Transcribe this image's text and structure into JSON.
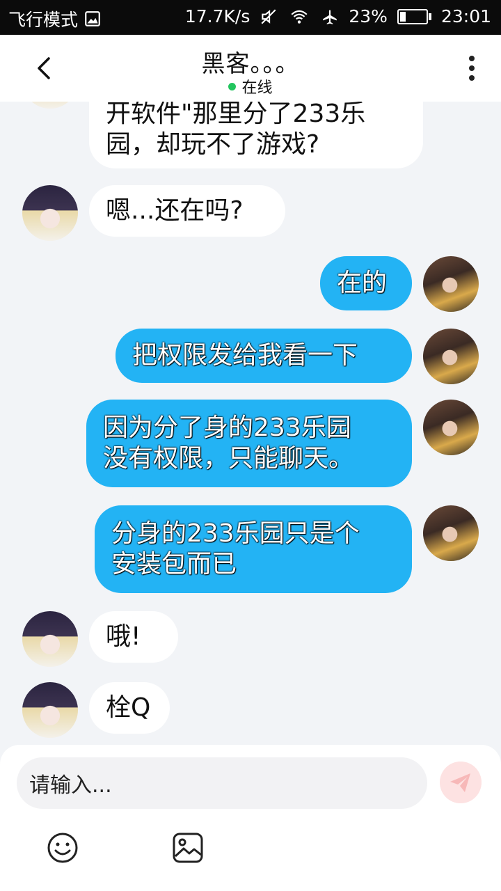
{
  "status_bar": {
    "mode": "飞行模式",
    "speed": "17.7K/s",
    "battery": "23%",
    "battery_level": 0.23,
    "time": "23:01"
  },
  "header": {
    "title": "黑客。。。",
    "status": "在线"
  },
  "messages": [
    {
      "side": "in",
      "lines": [
        "开软件\"那里分了233乐",
        "园，却玩不了游戏?"
      ]
    },
    {
      "side": "in",
      "lines": [
        "嗯...还在吗?"
      ]
    },
    {
      "side": "out",
      "lines": [
        "在的"
      ]
    },
    {
      "side": "out",
      "lines": [
        "把权限发给我看一下"
      ]
    },
    {
      "side": "out",
      "lines": [
        "因为分了身的233乐园",
        "没有权限，只能聊天。"
      ]
    },
    {
      "side": "out",
      "lines": [
        "分身的233乐园只是个",
        "安装包而已"
      ]
    },
    {
      "side": "in",
      "lines": [
        "哦!"
      ]
    },
    {
      "side": "in",
      "lines": [
        "栓Q"
      ]
    }
  ],
  "input": {
    "placeholder": "请输入..."
  },
  "icons": {
    "back": "chevron-left-icon",
    "more": "more-vertical-icon",
    "send": "send-icon",
    "emoji": "emoji-icon",
    "image": "image-icon"
  },
  "colors": {
    "outgoing_bubble": "#23b3f4",
    "incoming_bubble": "#ffffff",
    "online_dot": "#22c55e"
  }
}
